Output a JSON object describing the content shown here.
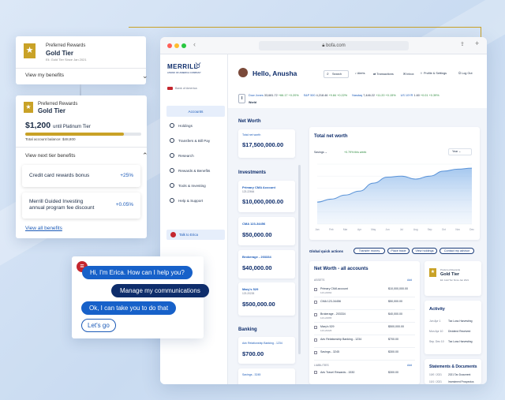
{
  "benefits_card": {
    "program": "Preferred Rewards",
    "tier": "Gold Tier",
    "since": "Eli. Gold Tier Since Jan 2021",
    "toggle_label": "View my benefits"
  },
  "tier_card": {
    "program": "Preferred Rewards",
    "tier": "Gold Tier",
    "amount": "$1,200",
    "amount_suffix": "until Platinum Tier",
    "balance_label": "Total account balance: $48,800",
    "progress": 0.85,
    "next_tier_label": "View next tier benefits",
    "benefits": [
      {
        "name": "Credit card rewards bonus",
        "value": "+25%"
      },
      {
        "name": "Merrill Guided Investing\nannual program fee discount",
        "value": "+0.05%"
      }
    ],
    "view_all": "View all benefits"
  },
  "chat": {
    "erica_intro": "Hi, I'm Erica. How can I help you?",
    "user_msg": "Manage my communications",
    "erica_reply": "Ok, I can take you to do that",
    "action": "Let's go"
  },
  "browser": {
    "url": "bofa.com",
    "brand": "MERRILL",
    "brand_sub": "A BANK OF AMERICA COMPANY",
    "boa_label": "Bank of America",
    "nav": [
      "Accounts",
      "Holdings",
      "Transfers & Bill Pay",
      "Research",
      "Rewards & Benefits",
      "Tools & Investing",
      "Help & Support"
    ],
    "talk_erica": "Talk to Erica",
    "greeting": "Hello, Anusha",
    "top_actions": [
      "Search",
      "Alerts",
      "Transactions",
      "Inbox",
      "Profile & Settings",
      "Log Out"
    ],
    "ticker": [
      {
        "name": "Dow Jones",
        "value": "33,681.72",
        "change": "+66.17",
        "pct": "+0.20%"
      },
      {
        "name": "S&P 500",
        "value": "4,218.46",
        "change": "+9.84",
        "pct": "+0.22%"
      },
      {
        "name": "Nasdaq",
        "value": "7,446.22",
        "change": "+11.20",
        "pct": "+0.15%"
      },
      {
        "name": "US 10YR",
        "value": "1.60",
        "change": "+0.01",
        "pct": "+0.39%"
      }
    ],
    "world_label": "World",
    "net_worth_heading": "Net Worth",
    "total_net_worth_label": "Total net worth",
    "total_net_worth": "$17,500,000.00",
    "investments_heading": "Investments",
    "accounts": [
      {
        "name": "Primary CMA Account",
        "id": "123-22664",
        "value": "$10,000,000.00"
      },
      {
        "name": "CMA 123-34456",
        "id": "",
        "value": "$50,000.00"
      },
      {
        "name": "Brokerage - 203334",
        "id": "",
        "value": "$40,000.00"
      },
      {
        "name": "Mary's 529",
        "id": "123-20226",
        "value": "$500,000.00"
      }
    ],
    "banking_heading": "Banking",
    "banking": [
      {
        "name": "Adv Relationship Banking - 1234",
        "value": "$700.00"
      },
      {
        "name": "Savings - 3245",
        "value": ""
      }
    ],
    "chart_card_title": "Total net worth",
    "chart_select": "Savings",
    "chart_change": "+0.79% this week",
    "chart_range": "Year",
    "chart_data": {
      "type": "area",
      "x": [
        "Jan",
        "Feb",
        "Mar",
        "Apr",
        "May",
        "Jun",
        "Jul",
        "Aug",
        "Sep",
        "Oct",
        "Nov",
        "Dec"
      ],
      "values": [
        1.1,
        1.25,
        1.45,
        1.65,
        2.05,
        2.35,
        2.4,
        2.25,
        2.4,
        2.65,
        2.75,
        2.8
      ],
      "ylim": [
        0,
        3
      ]
    },
    "quick_actions_label": "Global quick actions",
    "quick_actions": [
      "Transfer money",
      "Place trade",
      "View holdings",
      "Contact my advisor"
    ],
    "nw_all_title": "Net Worth - all accounts",
    "nw_assets_label": "ASSETS",
    "nw_add": "Add",
    "nw_rows": [
      {
        "name": "Primary CMA account",
        "sub": "123-22664",
        "value": "$10,000,000.00"
      },
      {
        "name": "CMA 123-34456",
        "sub": "",
        "value": "$50,000.00"
      },
      {
        "name": "Brokerage - 203334",
        "sub": "123-22665",
        "value": "$40,000.00"
      },
      {
        "name": "Mary's 529",
        "sub": "123-20226",
        "value": "$500,000.00"
      },
      {
        "name": "Adv Relationship Banking - 1234",
        "sub": "",
        "value": "$700.00"
      },
      {
        "name": "Savings - 3245",
        "sub": "",
        "value": "$300.00"
      }
    ],
    "liabilities_label": "LIABILITIES",
    "liability_row": {
      "name": "Adv Travel Rewards - 1530",
      "value": "$300.00"
    },
    "gold_mini": {
      "program": "Preferred Rewards",
      "tier": "Gold Tier",
      "since": "Eli. Gold Tier Since Jan 2021"
    },
    "activity_title": "Activity",
    "activity": [
      {
        "date": "Jun Apr 1",
        "text": "Tax Loss Harvesting"
      },
      {
        "date": "Mon Apr 10",
        "text": "Dividend Received"
      },
      {
        "date": "Sep. Dec 10",
        "text": "Tax Loss Harvesting"
      }
    ],
    "statements_title": "Statements & Documents",
    "statements": [
      {
        "date": "10/0 / 2021",
        "text": "2021 Tax Document"
      },
      {
        "date": "10/1 / 2021",
        "text": "Investment Prospectus"
      }
    ],
    "accent": "#c9a227",
    "brand_blue": "#0e2d6b"
  }
}
